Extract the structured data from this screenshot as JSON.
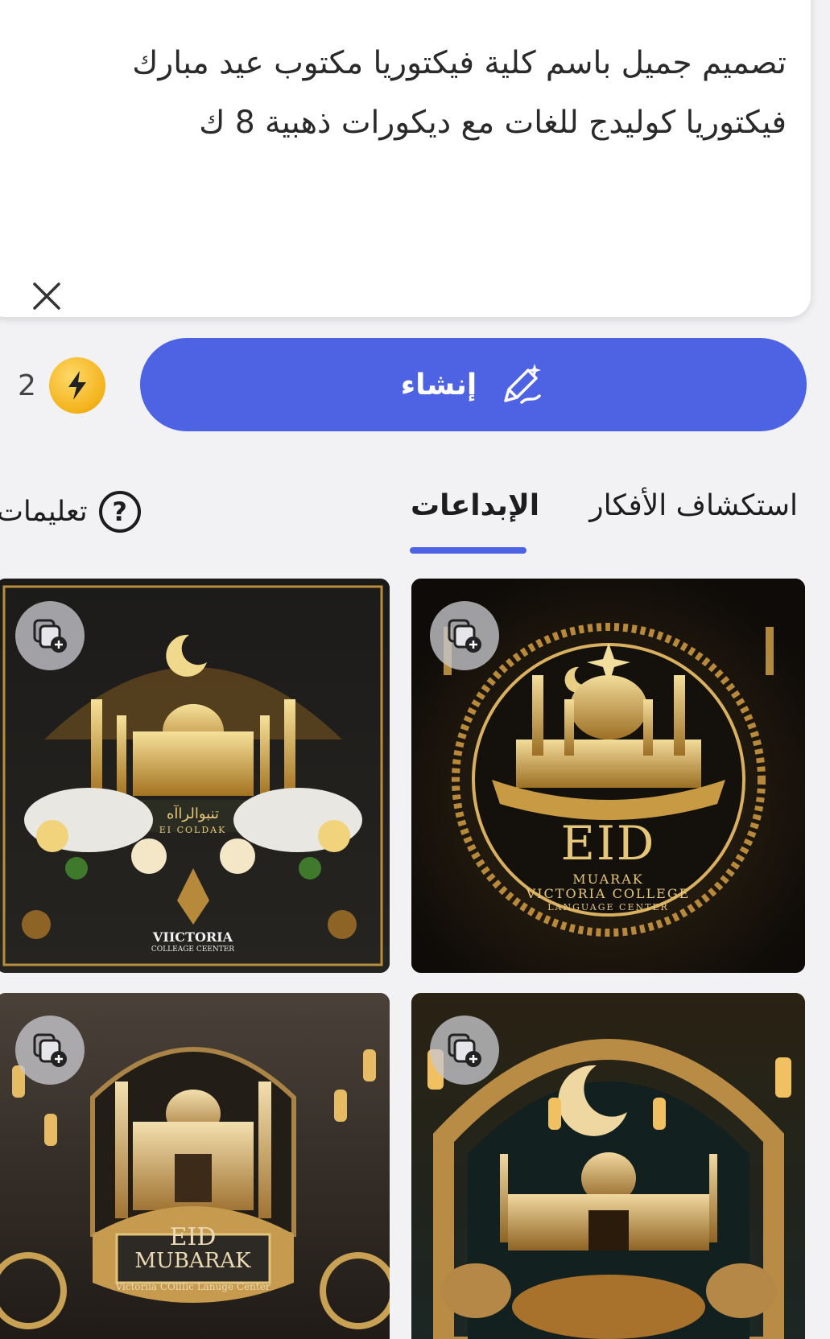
{
  "prompt": {
    "text": "تصميم جميل باسم كلية فيكتوريا  مكتوب عيد مبارك فيكتوريا كوليدج للغات مع ديكورات ذهبية 8 ك"
  },
  "credits": {
    "count": "2",
    "icon": "lightning-coin-icon"
  },
  "create_button": {
    "label": "إنشاء",
    "icon": "magic-pen-icon"
  },
  "tabs": [
    {
      "label": "استكشاف الأفكار",
      "active": false
    },
    {
      "label": "الإبداعات",
      "active": true
    }
  ],
  "help": {
    "label": "تعليمات",
    "icon": "question-mark-icon"
  },
  "gallery": [
    {
      "lines": [
        "EID",
        "MUARAK",
        "VICTORIA COLLEGE",
        "LANGUAGE CENTER"
      ]
    },
    {
      "lines": [
        "تنبوالراآه",
        "EI COLDAK",
        "VIICTORIA",
        "COLLEAGE CEENTER"
      ]
    },
    {
      "lines": []
    },
    {
      "lines": [
        "EID",
        "MUBARAK",
        "Victoriia COllIic Lanuge Center"
      ]
    }
  ],
  "colors": {
    "accent": "#4e63e4",
    "gold": "#e6c77a",
    "coin": "#f3b21a"
  }
}
